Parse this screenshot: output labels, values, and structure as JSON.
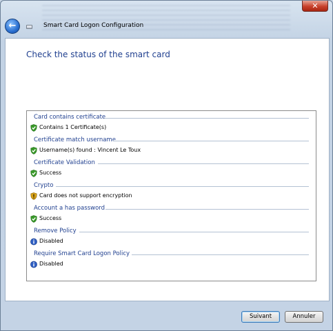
{
  "window": {
    "title": "Smart Card Logon Configuration",
    "close_label": "✕"
  },
  "page": {
    "heading": "Check the status of the smart card"
  },
  "checks": [
    {
      "title": "Card contains certificate",
      "status": "success",
      "text": "Contains 1 Certificate(s)"
    },
    {
      "title": "Certificate match username",
      "status": "success",
      "text": "Username(s) found : Vincent Le Toux"
    },
    {
      "title": "Certificate Validation",
      "status": "success",
      "text": "Success"
    },
    {
      "title": "Crypto",
      "status": "warning",
      "text": "Card does not support encryption"
    },
    {
      "title": "Account a has password",
      "status": "success",
      "text": "Success"
    },
    {
      "title": "Remove Policy",
      "status": "info",
      "text": "Disabled"
    },
    {
      "title": "Require Smart Card Logon Policy",
      "status": "info",
      "text": "Disabled"
    }
  ],
  "buttons": {
    "next_label": "Suivant",
    "cancel_label": "Annuler"
  },
  "icons": {
    "success": "green-shield-check-icon",
    "warning": "yellow-shield-warning-icon",
    "info": "blue-info-icon"
  },
  "colors": {
    "heading": "#1f3f8f",
    "group_title": "#1f3f8f",
    "success": "#3a9a2a",
    "warning": "#d9a419",
    "info": "#2f5fc4"
  }
}
